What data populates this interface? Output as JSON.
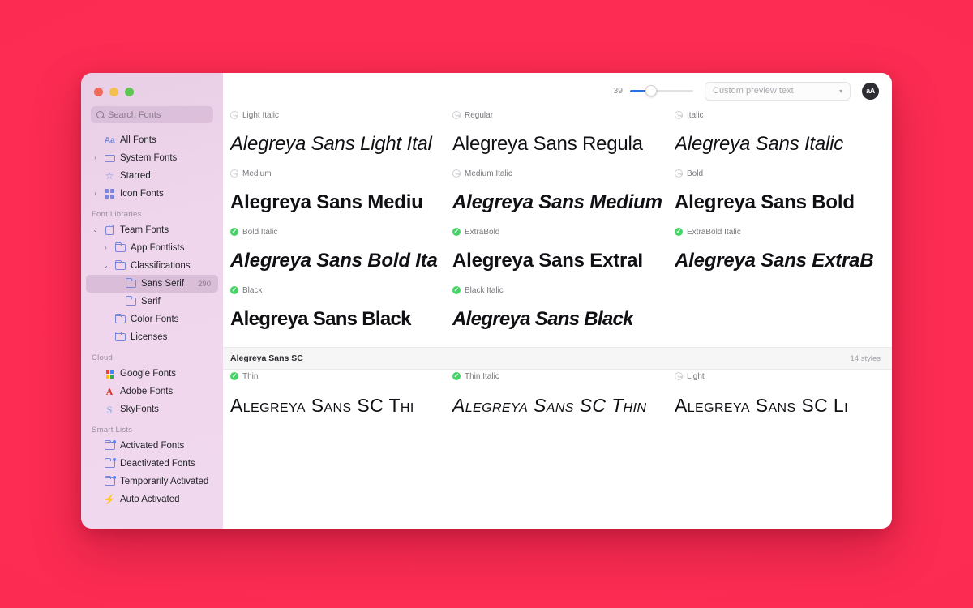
{
  "window": {
    "traffic_lights": [
      "close",
      "minimize",
      "zoom"
    ]
  },
  "sidebar": {
    "search": {
      "placeholder": "Search Fonts",
      "value": ""
    },
    "top_items": [
      {
        "label": "All Fonts",
        "icon": "aa-icon",
        "expandable": false
      },
      {
        "label": "System Fonts",
        "icon": "screen-icon",
        "expandable": true
      },
      {
        "label": "Starred",
        "icon": "star-icon",
        "expandable": false
      },
      {
        "label": "Icon Fonts",
        "icon": "grid-icon",
        "expandable": true
      }
    ],
    "sections": [
      {
        "title": "Font Libraries",
        "items": [
          {
            "label": "Team Fonts",
            "icon": "bag-icon",
            "expandable": true,
            "expanded": true,
            "indent": 0,
            "count": ""
          },
          {
            "label": "App Fontlists",
            "icon": "folder-icon",
            "expandable": true,
            "expanded": false,
            "indent": 1,
            "count": ""
          },
          {
            "label": "Classifications",
            "icon": "folder-icon",
            "expandable": true,
            "expanded": true,
            "indent": 1,
            "count": ""
          },
          {
            "label": "Sans Serif",
            "icon": "folder-icon",
            "expandable": false,
            "expanded": false,
            "indent": 2,
            "count": "290",
            "selected": true
          },
          {
            "label": "Serif",
            "icon": "folder-icon",
            "expandable": false,
            "expanded": false,
            "indent": 2,
            "count": ""
          },
          {
            "label": "Color Fonts",
            "icon": "folder-icon",
            "expandable": false,
            "expanded": false,
            "indent": 1,
            "count": ""
          },
          {
            "label": "Licenses",
            "icon": "folder-icon",
            "expandable": false,
            "expanded": false,
            "indent": 1,
            "count": ""
          }
        ]
      },
      {
        "title": "Cloud",
        "items": [
          {
            "label": "Google Fonts",
            "icon": "google-icon",
            "indent": 0,
            "count": ""
          },
          {
            "label": "Adobe Fonts",
            "icon": "adobe-icon",
            "indent": 0,
            "count": ""
          },
          {
            "label": "SkyFonts",
            "icon": "sky-icon",
            "indent": 0,
            "count": ""
          }
        ]
      },
      {
        "title": "Smart Lists",
        "items": [
          {
            "label": "Activated Fonts",
            "icon": "folder-dot-icon",
            "indent": 0,
            "count": ""
          },
          {
            "label": "Deactivated Fonts",
            "icon": "folder-dot-icon",
            "indent": 0,
            "count": ""
          },
          {
            "label": "Temporarily Activated",
            "icon": "folder-dot-icon",
            "indent": 0,
            "count": ""
          },
          {
            "label": "Auto Activated",
            "icon": "bolt-icon",
            "indent": 0,
            "count": ""
          }
        ]
      }
    ]
  },
  "toolbar": {
    "size_value": "39",
    "preview_text_placeholder": "Custom preview text",
    "preview_text_value": "",
    "aa_button_label": "aA"
  },
  "font_grid": {
    "rows": [
      [
        {
          "style": "Light Italic",
          "activated": false,
          "sample": "Alegreya Sans Light Ital",
          "weight": "w-light",
          "italic": true
        },
        {
          "style": "Regular",
          "activated": false,
          "sample": "Alegreya Sans Regula",
          "weight": "w-reg",
          "italic": false
        },
        {
          "style": "Italic",
          "activated": false,
          "sample": "Alegreya Sans Italic",
          "weight": "w-reg",
          "italic": true
        }
      ],
      [
        {
          "style": "Medium",
          "activated": false,
          "sample": "Alegreya Sans Mediu",
          "weight": "w-med",
          "italic": false
        },
        {
          "style": "Medium Italic",
          "activated": false,
          "sample": "Alegreya Sans Medium",
          "weight": "w-med",
          "italic": true
        },
        {
          "style": "Bold",
          "activated": false,
          "sample": "Alegreya Sans Bold",
          "weight": "w-bold",
          "italic": false
        }
      ],
      [
        {
          "style": "Bold Italic",
          "activated": true,
          "sample": "Alegreya Sans Bold Ita",
          "weight": "w-bold",
          "italic": true
        },
        {
          "style": "ExtraBold",
          "activated": true,
          "sample": "Alegreya Sans ExtraI",
          "weight": "w-xbold",
          "italic": false
        },
        {
          "style": "ExtraBold Italic",
          "activated": true,
          "sample": "Alegreya Sans ExtraB",
          "weight": "w-xbold",
          "italic": true
        }
      ],
      [
        {
          "style": "Black",
          "activated": true,
          "sample": "Alegreya Sans Black",
          "weight": "w-black",
          "italic": false
        },
        {
          "style": "Black Italic",
          "activated": true,
          "sample": "Alegreya Sans Black",
          "weight": "w-black",
          "italic": true
        },
        {
          "style": "",
          "activated": null,
          "sample": "",
          "weight": "w-reg",
          "italic": false
        }
      ]
    ]
  },
  "next_section": {
    "family_name": "Alegreya Sans SC",
    "style_count": "14 styles",
    "rows": [
      [
        {
          "style": "Thin",
          "activated": true,
          "sample": "Alegreya Sans SC Thi",
          "weight": "w-light",
          "italic": false
        },
        {
          "style": "Thin Italic",
          "activated": true,
          "sample": "Alegreya Sans SC Thin",
          "weight": "w-light",
          "italic": true
        },
        {
          "style": "Light",
          "activated": false,
          "sample": "Alegreya Sans SC Li",
          "weight": "w-reg",
          "italic": false
        }
      ]
    ]
  }
}
